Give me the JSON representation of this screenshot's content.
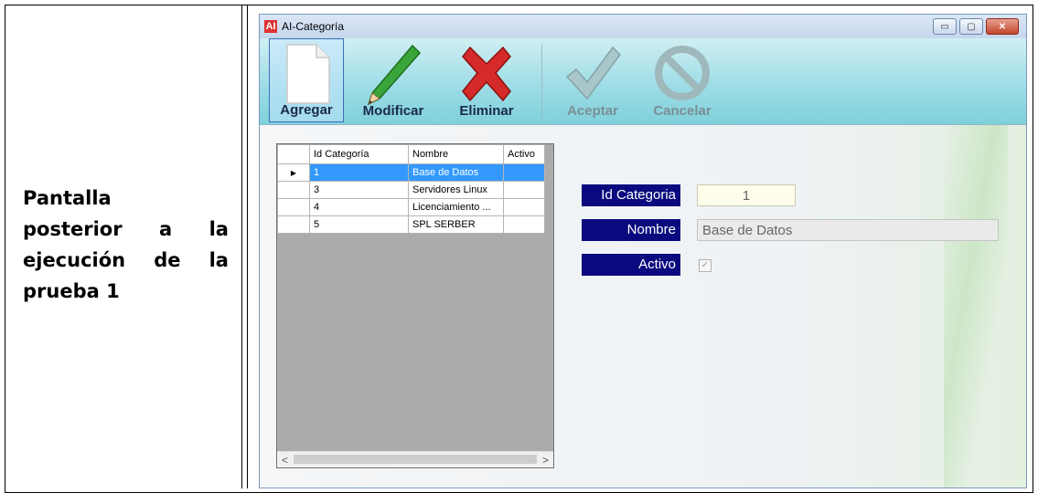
{
  "doc": {
    "label_lines": [
      [
        "Pantalla"
      ],
      [
        "posterior",
        "a",
        "la"
      ],
      [
        "ejecución",
        "de",
        "la"
      ],
      [
        "prueba 1"
      ]
    ]
  },
  "window": {
    "icon_text": "AI",
    "title": "AI-Categoría",
    "buttons": {
      "minimize": "▭",
      "maximize": "▢",
      "close": "✕"
    }
  },
  "toolbar": {
    "agregar": "Agregar",
    "modificar": "Modificar",
    "eliminar": "Eliminar",
    "aceptar": "Aceptar",
    "cancelar": "Cancelar"
  },
  "grid": {
    "headers": [
      "Id Categoría",
      "Nombre",
      "Activo"
    ],
    "rows": [
      {
        "id": "1",
        "nombre": "Base de Datos",
        "activo": ""
      },
      {
        "id": "3",
        "nombre": "Servidores Linux",
        "activo": ""
      },
      {
        "id": "4",
        "nombre": "Licenciamiento ...",
        "activo": ""
      },
      {
        "id": "5",
        "nombre": "SPL SERBER",
        "activo": ""
      }
    ],
    "selected_row_marker": "▶",
    "scroll_left": "<",
    "scroll_right": ">"
  },
  "form": {
    "id_label": "Id Categoria",
    "id_value": "1",
    "nombre_label": "Nombre",
    "nombre_value": "Base de Datos",
    "activo_label": "Activo",
    "activo_checked": true
  },
  "colors": {
    "label_bg": "#0a0a7e",
    "selection": "#3399ff",
    "toolbar": "#9edde6"
  }
}
